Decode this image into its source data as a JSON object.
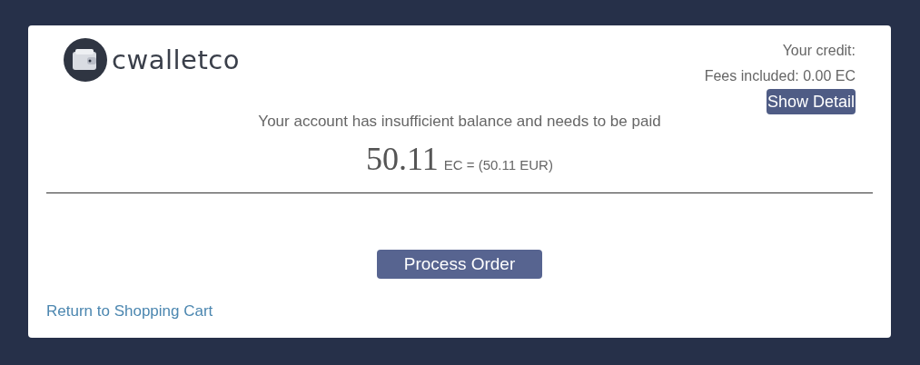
{
  "logo": {
    "text": "cwalletco"
  },
  "credit": {
    "label": "Your credit:",
    "fees": "Fees included: 0.00 EC",
    "detail_button": "Show Detail"
  },
  "message": "Your account has insufficient balance and needs to be paid",
  "amount": {
    "value": "50.11",
    "unit": "EC = (50.11 EUR)"
  },
  "process_button": "Process Order",
  "return_link": "Return to Shopping Cart"
}
